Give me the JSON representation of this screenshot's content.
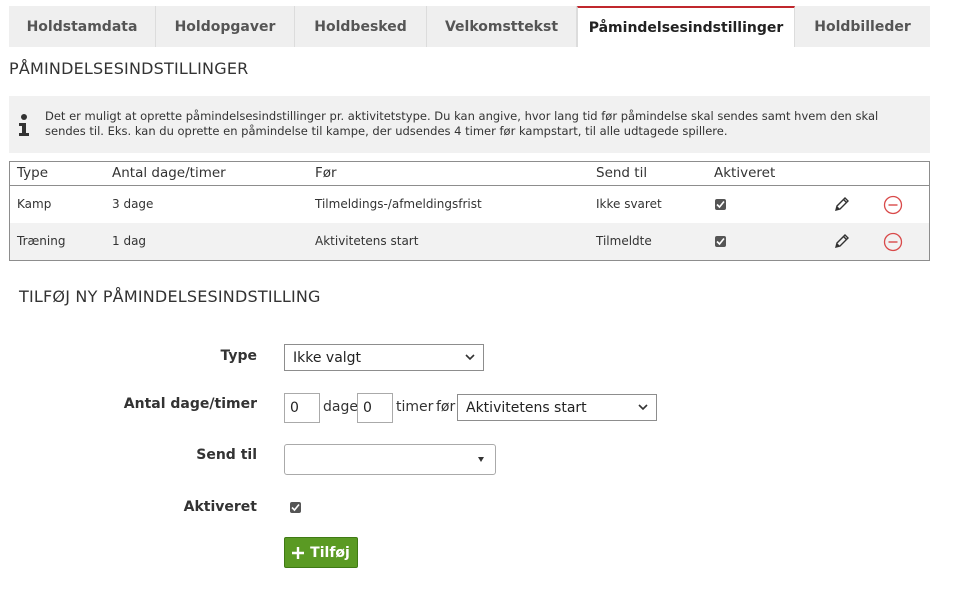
{
  "tabs": [
    {
      "label": "Holdstamdata",
      "active": false
    },
    {
      "label": "Holdopgaver",
      "active": false
    },
    {
      "label": "Holdbesked",
      "active": false
    },
    {
      "label": "Velkomsttekst",
      "active": false
    },
    {
      "label": "Påmindelsesindstillinger",
      "active": true
    },
    {
      "label": "Holdbilleder",
      "active": false
    }
  ],
  "section_title": "PÅMINDELSESINDSTILLINGER",
  "info": {
    "icon": "info-icon",
    "text": "Det er muligt at oprette påmindelsesindstillinger pr. aktivitetstype. Du kan angive, hvor lang tid før påmindelse skal sendes samt hvem den skal sendes til. Eks. kan du oprette en påmindelse til kampe, der udsendes 4 timer før kampstart, til alle udtagede spillere."
  },
  "table": {
    "headers": {
      "type": "Type",
      "antal": "Antal dage/timer",
      "foer": "Før",
      "send_til": "Send til",
      "aktiveret": "Aktiveret"
    },
    "rows": [
      {
        "type": "Kamp",
        "antal": "3 dage",
        "foer": "Tilmeldings-/afmeldingsfrist",
        "send_til": "Ikke svaret",
        "aktiveret": true
      },
      {
        "type": "Træning",
        "antal": "1 dag",
        "foer": "Aktivitetens start",
        "send_til": "Tilmeldte",
        "aktiveret": true
      }
    ]
  },
  "form": {
    "title": "TILFØJ NY PÅMINDELSESINDSTILLING",
    "type_label": "Type",
    "type_value": "Ikke valgt",
    "antal_label": "Antal dage/timer",
    "days_value": "0",
    "days_word": "dage",
    "hours_value": "0",
    "hours_word": "timer",
    "foer_word": "før",
    "foer_value": "Aktivitetens start",
    "send_til_label": "Send til",
    "send_til_value": "",
    "aktiveret_label": "Aktiveret",
    "aktiveret_checked": true,
    "add_button": "Tilføj"
  },
  "colors": {
    "active_tab_accent": "#c0272d",
    "add_button": "#5a9a23",
    "remove_icon": "#d94a4a"
  }
}
